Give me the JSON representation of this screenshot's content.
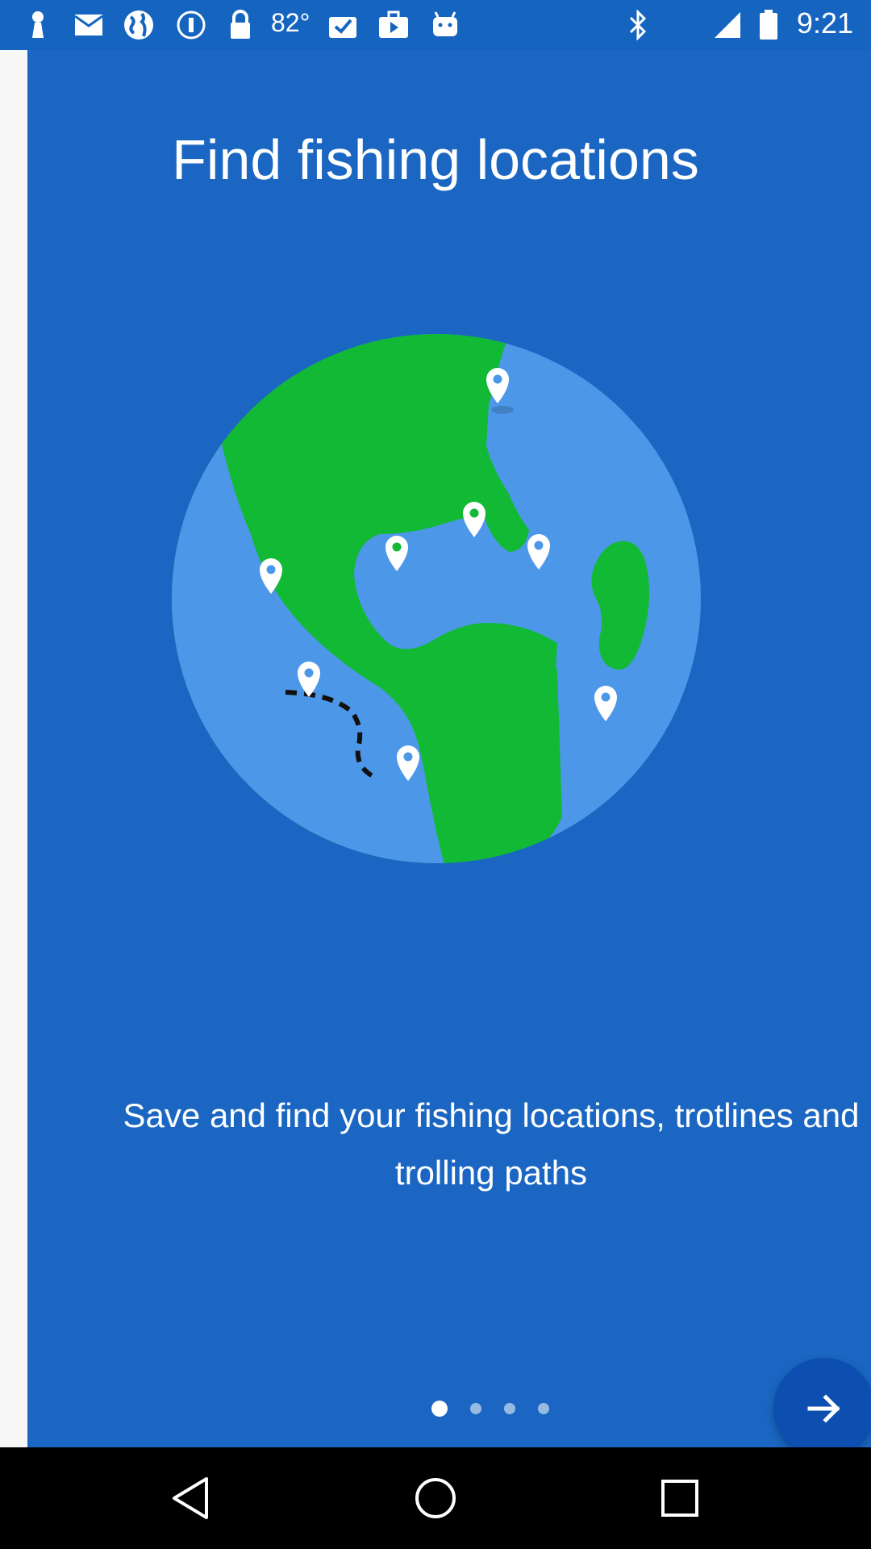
{
  "status_bar": {
    "temperature": "82°",
    "time": "9:21",
    "icons": [
      "keyhole-icon",
      "mail-icon",
      "globe-icon",
      "info-circle-icon",
      "lock-icon",
      "clipboard-check-icon",
      "briefcase-play-icon",
      "android-icon",
      "bluetooth-icon",
      "signal-icon",
      "battery-icon"
    ]
  },
  "onboarding": {
    "title": "Find fishing locations",
    "description": "Save and find your fishing locations, trotlines and trolling paths",
    "page_indicator": {
      "total_pages": 4,
      "current_page": 1
    },
    "next_button_icon": "arrow-right-icon"
  },
  "colors": {
    "background": "#1a66c2",
    "ocean": "#4d97e8",
    "land": "#11b935",
    "next_button": "#0d4fb0"
  },
  "nav_bar": {
    "icons": [
      "back-icon",
      "home-icon",
      "recents-icon"
    ]
  }
}
